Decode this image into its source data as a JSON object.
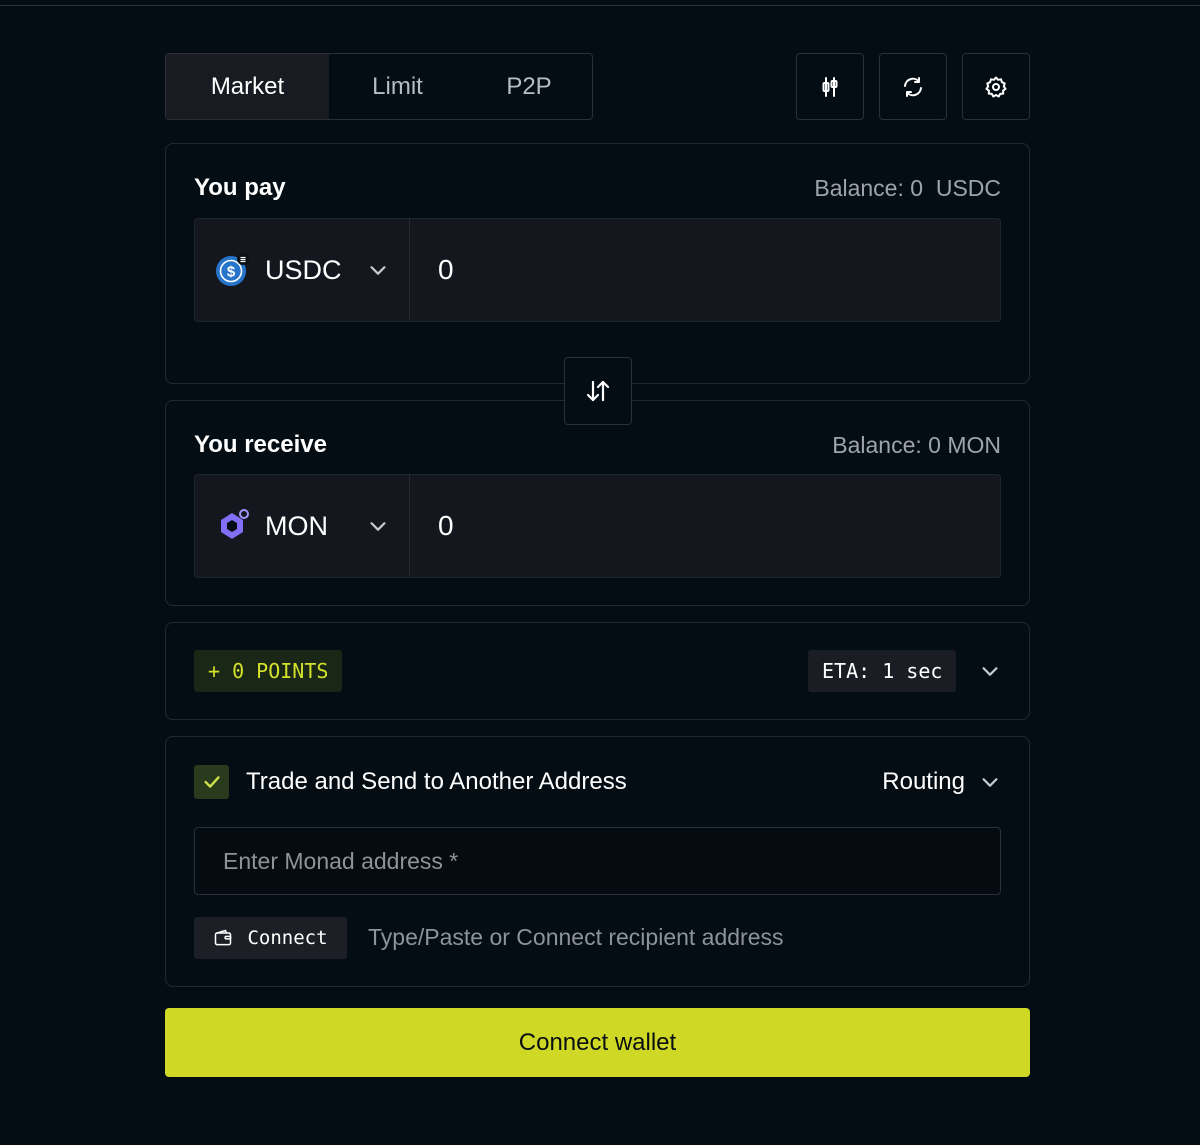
{
  "tabs": [
    {
      "label": "Market",
      "active": true
    },
    {
      "label": "Limit",
      "active": false
    },
    {
      "label": "P2P",
      "active": false
    }
  ],
  "toolbar": {
    "icons": [
      "chart-settings-icon",
      "refresh-icon",
      "gear-icon"
    ]
  },
  "pay": {
    "title": "You pay",
    "balance": "Balance: 0  USDC",
    "token": "USDC",
    "amount": "0"
  },
  "receive": {
    "title": "You receive",
    "balance": "Balance: 0 MON",
    "token": "MON",
    "amount": "0"
  },
  "info": {
    "points": "+ 0 POINTS",
    "eta": "ETA: 1 sec"
  },
  "send": {
    "checked": true,
    "label": "Trade and Send to Another Address",
    "routing_label": "Routing",
    "address_placeholder": "Enter Monad address *",
    "address_value": "",
    "connect_label": "Connect",
    "hint": "Type/Paste or Connect recipient address"
  },
  "cta": {
    "label": "Connect wallet"
  },
  "colors": {
    "background": "#040d13",
    "accent": "#d0d826",
    "points_text": "#d4e12b",
    "usdc_blue": "#2775ca",
    "monad_purple": "#836ef9"
  }
}
